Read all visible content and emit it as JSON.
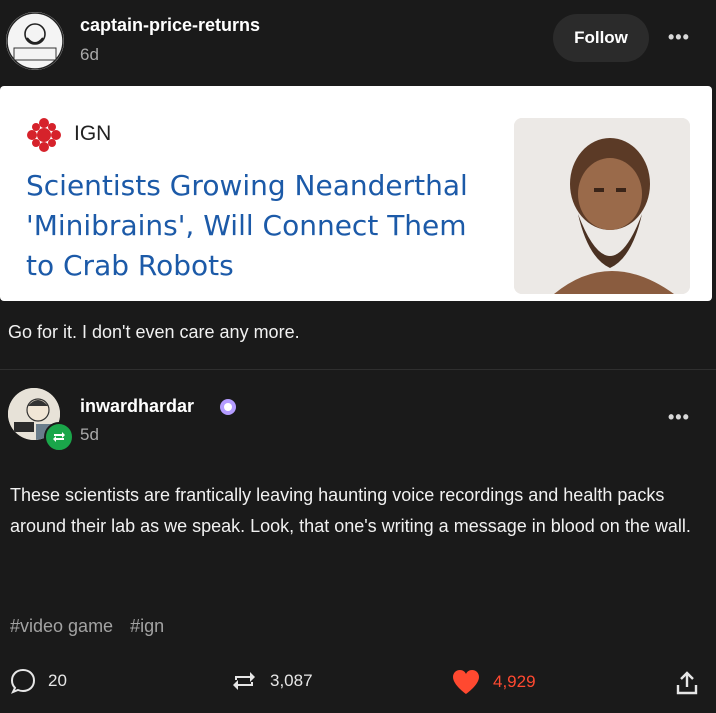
{
  "post": {
    "author": "captain-price-returns",
    "time": "6d",
    "follow_label": "Follow",
    "more_glyph": "•••",
    "link_card": {
      "source": "IGN",
      "headline": "Scientists Growing Neanderthal 'Minibrains', Will Connect Them to Crab Robots"
    },
    "caption": "Go for it. I don't even care any more."
  },
  "reblog": {
    "author": "inwardhardar",
    "time": "5d",
    "more_glyph": "•••",
    "body": "These scientists are frantically leaving haunting voice recordings and health packs around their lab as we speak. Look, that one's writing a message in blood on the wall.",
    "tags": [
      "#video game",
      "#ign"
    ]
  },
  "footer": {
    "comments": "20",
    "reblogs": "3,087",
    "likes": "4,929",
    "colors": {
      "like": "#ff4930",
      "text": "#e6e6e6"
    }
  },
  "icons": [
    "avatar",
    "ign-logo",
    "reblog-icon",
    "verified-badge-icon",
    "comment-icon",
    "like-heart-icon",
    "share-icon"
  ]
}
